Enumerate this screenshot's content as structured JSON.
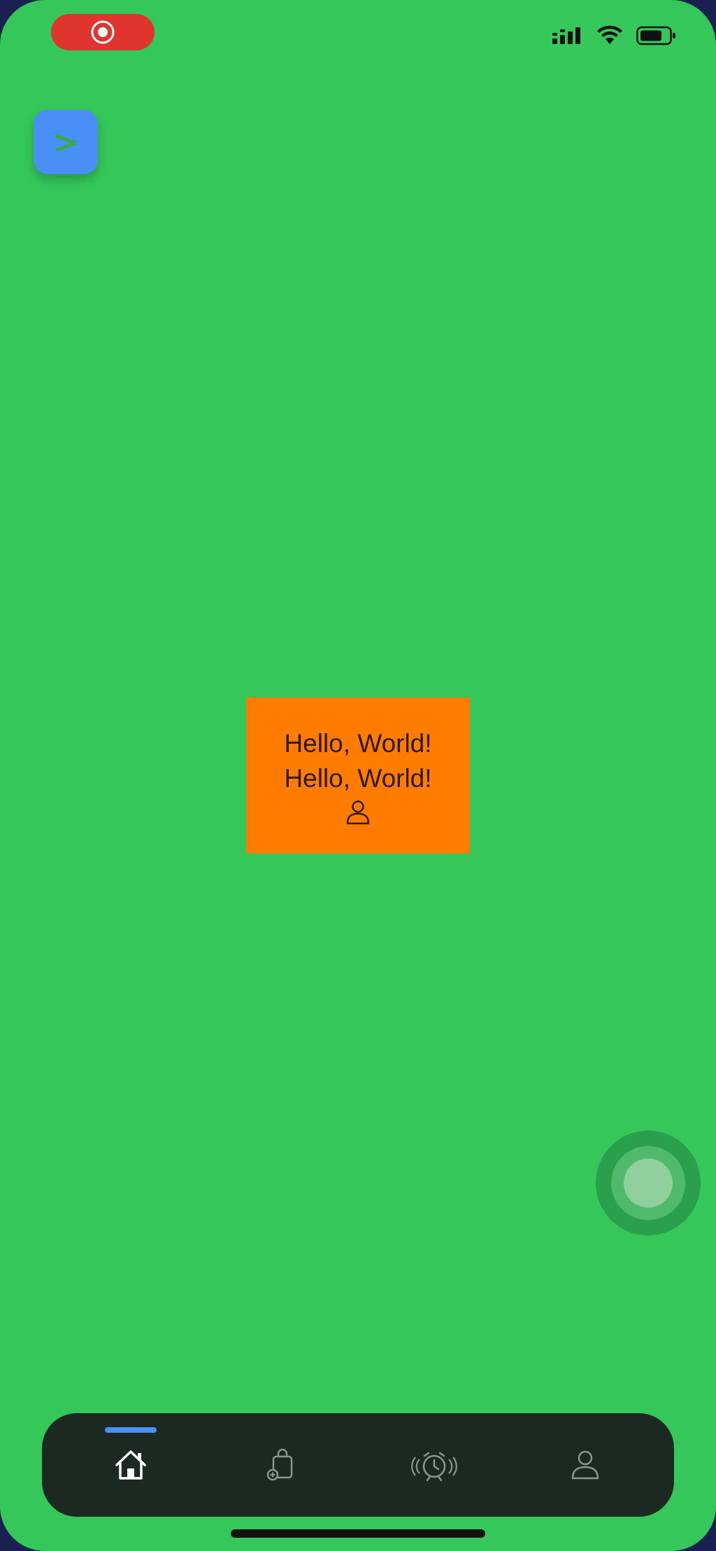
{
  "status_bar": {
    "recording_icon": "screen-recording-icon",
    "signal_icon": "cellular-signal-icon",
    "wifi_icon": "wifi-icon",
    "battery_icon": "battery-icon"
  },
  "floating_button": {
    "label": ">",
    "color": "#4a8ff5"
  },
  "card": {
    "line1": "Hello, World!",
    "line2": "Hello, World!",
    "icon": "person-icon",
    "color": "#ff7c00"
  },
  "tabbar": {
    "tabs": [
      {
        "icon": "home-icon",
        "selected": true
      },
      {
        "icon": "bag-add-icon",
        "selected": false
      },
      {
        "icon": "alarm-clock-icon",
        "selected": false
      },
      {
        "icon": "person-icon",
        "selected": false
      }
    ],
    "accent": "#4a8ff5"
  },
  "colors": {
    "background": "#35c75a",
    "tabbar": "#1b2920",
    "recording": "#e0342f"
  }
}
